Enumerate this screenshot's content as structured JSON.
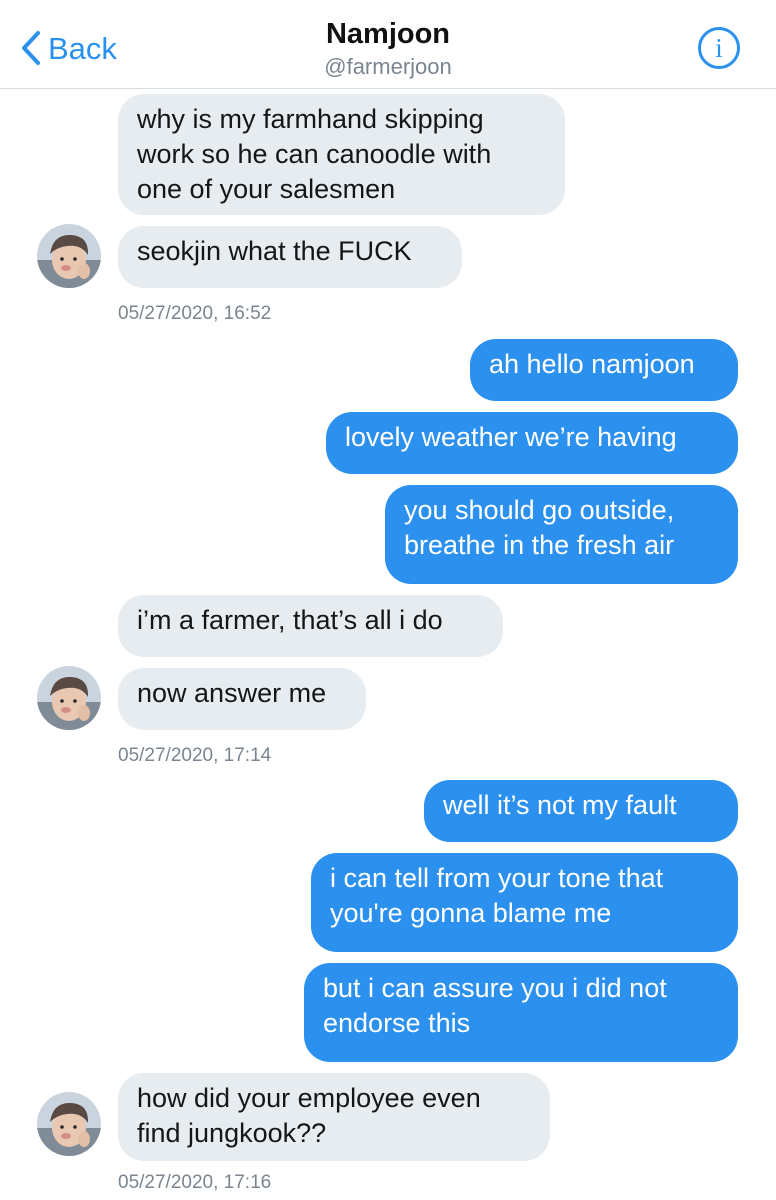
{
  "header": {
    "back_label": "Back",
    "title": "Namjoon",
    "handle": "@farmerjoon",
    "info_glyph": "i",
    "accent_color": "#2a91ee",
    "icons": [
      "chevron-left-icon",
      "info-icon"
    ]
  },
  "messages": [
    {
      "side": "received",
      "text": "why is my farmhand skipping\nwork so he can canoodle with\none of your salesmen"
    },
    {
      "side": "received",
      "text": "seokjin what the FUCK"
    },
    {
      "side": "timestamp",
      "text": "05/27/2020, 16:52"
    },
    {
      "side": "sent",
      "text": "ah hello namjoon"
    },
    {
      "side": "sent",
      "text": "lovely weather we’re having"
    },
    {
      "side": "sent",
      "text": "you should go outside,\nbreathe in the fresh air"
    },
    {
      "side": "received",
      "text": "i’m a farmer, that’s all i do"
    },
    {
      "side": "received",
      "text": "now answer me"
    },
    {
      "side": "timestamp",
      "text": "05/27/2020, 17:14"
    },
    {
      "side": "sent",
      "text": "well it’s not my fault"
    },
    {
      "side": "sent",
      "text": "i can tell from your tone that\nyou're gonna blame me"
    },
    {
      "side": "sent",
      "text": "but i can assure you i did not\nendorse this"
    },
    {
      "side": "received",
      "text": "how did your employee even\nfind jungkook??"
    },
    {
      "side": "timestamp",
      "text": "05/27/2020, 17:16"
    }
  ],
  "colors": {
    "sent_bubble": "#2c91ee",
    "received_bubble": "#e6ecf0",
    "timestamp_text": "#7a8590"
  }
}
